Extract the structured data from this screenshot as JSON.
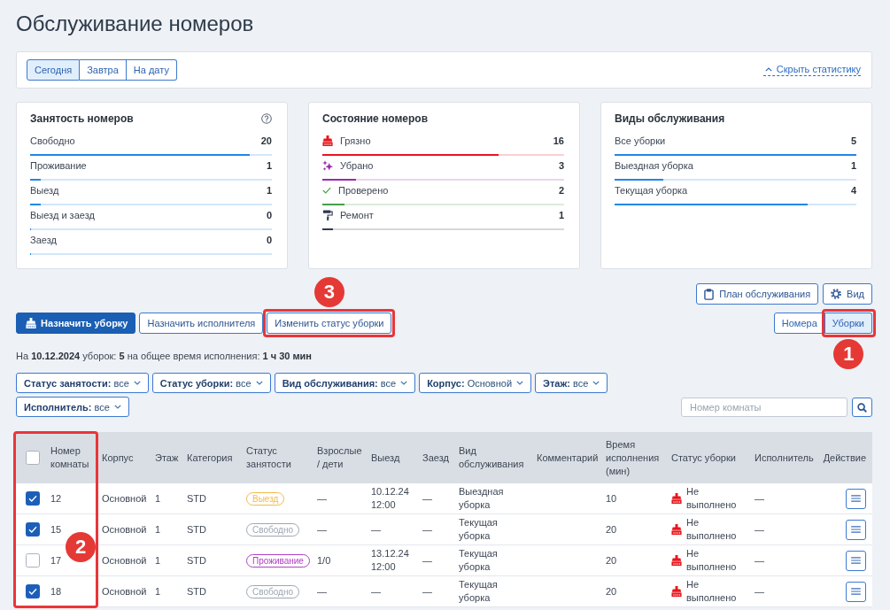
{
  "page": {
    "title": "Обслуживание номеров"
  },
  "date_tabs": [
    {
      "label": "Сегодня",
      "selected": true
    },
    {
      "label": "Завтра",
      "selected": false
    },
    {
      "label": "На дату",
      "selected": false
    }
  ],
  "stats_toggle": {
    "label": "Скрыть статистику"
  },
  "stat_cards": [
    {
      "title": "Занятость номеров",
      "help": true,
      "rows": [
        {
          "label": "Свободно",
          "value": "20",
          "level": 0.91
        },
        {
          "label": "Проживание",
          "value": "1",
          "level": 0.045
        },
        {
          "label": "Выезд",
          "value": "1",
          "level": 0.045
        },
        {
          "label": "Выезд и заезд",
          "value": "0",
          "level": 0
        },
        {
          "label": "Заезд",
          "value": "0",
          "level": 0
        }
      ]
    },
    {
      "title": "Состояние номеров",
      "help": false,
      "rows": [
        {
          "kind": "dirty",
          "label": "Грязно",
          "value": "16",
          "level": 0.73,
          "color": "#e8161c"
        },
        {
          "kind": "cleaned",
          "label": "Убрано",
          "value": "3",
          "level": 0.14,
          "color": "#9c27b0"
        },
        {
          "kind": "inspected",
          "label": "Проверено",
          "value": "2",
          "level": 0.09,
          "color": "#43a047"
        },
        {
          "kind": "repair",
          "label": "Ремонт",
          "value": "1",
          "level": 0.045,
          "color": "#2e3a4f"
        }
      ]
    },
    {
      "title": "Виды обслуживания",
      "help": false,
      "rows": [
        {
          "label": "Все уборки",
          "value": "5",
          "level": 1
        },
        {
          "label": "Выездная уборка",
          "value": "1",
          "level": 0.2
        },
        {
          "label": "Текущая уборка",
          "value": "4",
          "level": 0.8
        }
      ]
    }
  ],
  "top_actions": [
    {
      "kind": "plan",
      "label": "План обслуживания"
    },
    {
      "kind": "view",
      "label": "Вид"
    }
  ],
  "actions": [
    {
      "kind": "primary",
      "label": "Назначить уборку"
    },
    {
      "kind": "secondary",
      "label": "Назначить исполнителя"
    },
    {
      "kind": "secondary",
      "label": "Изменить статус уборки",
      "callout": "3"
    }
  ],
  "view_tabs": [
    {
      "label": "Номера",
      "selected": false
    },
    {
      "label": "Уборки",
      "selected": true,
      "callout": "1"
    }
  ],
  "summary": "На **10.12.2024** уборок: **5** на общее время исполнения: **1 ч 30 мин**",
  "filters": [
    {
      "label": "Статус занятости:",
      "value": "все"
    },
    {
      "label": "Статус уборки:",
      "value": "все"
    },
    {
      "label": "Вид обслуживания:",
      "value": "все"
    },
    {
      "label": "Корпус:",
      "value": "Основной"
    },
    {
      "label": "Этаж:",
      "value": "все"
    },
    {
      "label": "Исполнитель:",
      "value": "все"
    }
  ],
  "search": {
    "placeholder": "Номер комнаты"
  },
  "table": {
    "callout": "2",
    "select_all": {
      "checked": false
    },
    "columns": [
      "Номер комнаты",
      "Корпус",
      "Этаж",
      "Категория",
      "Статус занятости",
      "Взрослые / дети",
      "Выезд",
      "Заезд",
      "Вид обслуживания",
      "Комментарий",
      "Время исполнения (мин)",
      "Статус уборки",
      "Исполнитель",
      "Действие"
    ],
    "rows": [
      {
        "checked": true,
        "room": "12",
        "building": "Основной",
        "floor": "1",
        "category": "STD",
        "occupancy": {
          "label": "Выезд",
          "color": "#f5b94a"
        },
        "guests": "—",
        "departure": "10.12.24 12:00",
        "arrival": "—",
        "service": "Выездная уборка",
        "duration": "10",
        "cleaning_status": {
          "kind": "dirty",
          "label": "Не выполнено"
        },
        "assignee": "—"
      },
      {
        "checked": true,
        "room": "15",
        "building": "Основной",
        "floor": "1",
        "category": "STD",
        "occupancy": {
          "label": "Свободно",
          "color": "#9ea6b1"
        },
        "guests": "—",
        "departure": "—",
        "arrival": "—",
        "service": "Текущая уборка",
        "duration": "20",
        "cleaning_status": {
          "kind": "dirty",
          "label": "Не выполнено"
        },
        "assignee": "—"
      },
      {
        "checked": false,
        "room": "17",
        "building": "Основной",
        "floor": "1",
        "category": "STD",
        "occupancy": {
          "label": "Проживание",
          "color": "#b03fc6"
        },
        "guests": "1/0",
        "departure": "13.12.24 12:00",
        "arrival": "—",
        "service": "Текущая уборка",
        "duration": "20",
        "cleaning_status": {
          "kind": "dirty",
          "label": "Не выполнено"
        },
        "assignee": "—"
      },
      {
        "checked": true,
        "room": "18",
        "building": "Основной",
        "floor": "1",
        "category": "STD",
        "occupancy": {
          "label": "Свободно",
          "color": "#9ea6b1"
        },
        "guests": "—",
        "departure": "—",
        "arrival": "—",
        "service": "Текущая уборка",
        "duration": "20",
        "cleaning_status": {
          "kind": "dirty",
          "label": "Не выполнено"
        },
        "assignee": "—"
      }
    ]
  }
}
